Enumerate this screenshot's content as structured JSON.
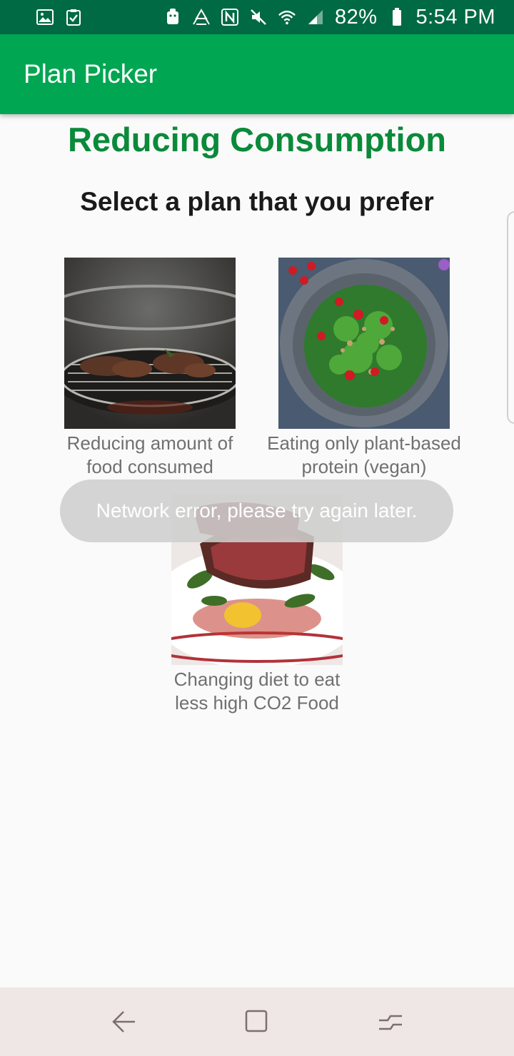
{
  "status_bar": {
    "battery_percent": "82%",
    "time": "5:54 PM",
    "icons_left": [
      "image-icon",
      "checklist-icon"
    ],
    "icons_right": [
      "android-icon",
      "recycle-icon",
      "nfc-icon",
      "mute-icon",
      "wifi-icon",
      "signal-icon",
      "battery-icon"
    ]
  },
  "app_bar": {
    "title": "Plan Picker",
    "background": "#00a651"
  },
  "main": {
    "heading": "Reducing Consumption",
    "subheading": "Select a plan that you prefer",
    "heading_color": "#0a8a3a",
    "plans": [
      {
        "caption_line1": "Reducing amount of",
        "caption_line2": "food consumed",
        "image": "grilled-meat-image"
      },
      {
        "caption_line1": "Eating only plant-based",
        "caption_line2": "protein (vegan)",
        "image": "vegan-salad-bowl-image"
      },
      {
        "caption_line1": "Changing diet to eat",
        "caption_line2": "less high CO2 Food",
        "image": "steak-plate-image"
      }
    ]
  },
  "toast": {
    "message": "Network error, please try again later."
  },
  "nav_bar": {
    "buttons": [
      "back-icon",
      "home-icon",
      "recent-apps-icon"
    ]
  }
}
